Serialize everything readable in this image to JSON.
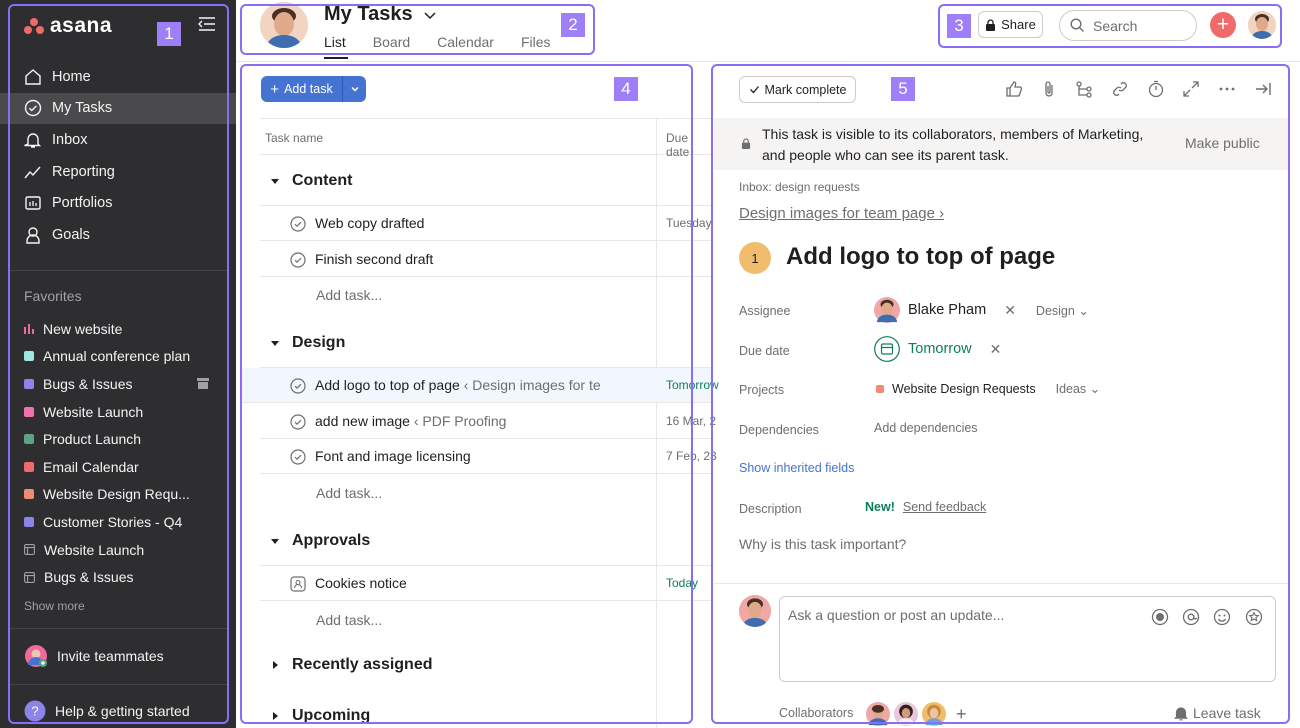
{
  "app": {
    "brand": "asana"
  },
  "sidebar": {
    "nav": [
      {
        "label": "Home",
        "icon": "home-icon"
      },
      {
        "label": "My Tasks",
        "icon": "check-circle-icon",
        "active": true
      },
      {
        "label": "Inbox",
        "icon": "bell-icon"
      },
      {
        "label": "Reporting",
        "icon": "trend-icon"
      },
      {
        "label": "Portfolios",
        "icon": "folder-icon"
      },
      {
        "label": "Goals",
        "icon": "person-icon"
      }
    ],
    "favorites_title": "Favorites",
    "favorites": [
      {
        "label": "New website",
        "color": "#f06a99",
        "kind": "bars"
      },
      {
        "label": "Annual conference plan",
        "color": "#9ee7e3",
        "kind": "square"
      },
      {
        "label": "Bugs & Issues",
        "color": "#8d84e8",
        "kind": "square",
        "archived": true
      },
      {
        "label": "Website Launch",
        "color": "#f26fb2",
        "kind": "square"
      },
      {
        "label": "Product Launch",
        "color": "#5da283",
        "kind": "square"
      },
      {
        "label": "Email Calendar",
        "color": "#f06a6a",
        "kind": "square"
      },
      {
        "label": "Website Design Requ...",
        "color": "#ec8d71",
        "kind": "square"
      },
      {
        "label": "Customer Stories - Q4",
        "color": "#8d84e8",
        "kind": "square"
      },
      {
        "label": "Website Launch",
        "color": "#a2a0a2",
        "kind": "table"
      },
      {
        "label": "Bugs & Issues",
        "color": "#a2a0a2",
        "kind": "table"
      }
    ],
    "show_more": "Show more",
    "invite": "Invite teammates",
    "help": "Help & getting started"
  },
  "header": {
    "title": "My Tasks",
    "tabs": [
      "List",
      "Board",
      "Calendar",
      "Files"
    ],
    "share": "Share",
    "search_placeholder": "Search"
  },
  "annotations": [
    "1",
    "2",
    "3",
    "4",
    "5"
  ],
  "list": {
    "add_task": "Add task",
    "columns": [
      "Task name",
      "Due date"
    ],
    "add_row": "Add task...",
    "sections": [
      {
        "name": "Content",
        "tasks": [
          {
            "name": "Web copy drafted",
            "crumb": "",
            "due": "Tuesday",
            "due_color": "#6d6e6f"
          },
          {
            "name": "Finish second draft",
            "crumb": "",
            "due": "",
            "due_color": "#6d6e6f"
          }
        ]
      },
      {
        "name": "Design",
        "tasks": [
          {
            "name": "Add logo to top of page",
            "crumb": "‹ Design images for te",
            "due": "Tomorrow",
            "due_color": "#0d7f56",
            "highlight": true
          },
          {
            "name": "add new image",
            "crumb": "‹ PDF Proofing",
            "due": "16 Mar, 2",
            "due_color": "#6d6e6f"
          },
          {
            "name": "Font and image licensing",
            "crumb": "",
            "due": "7 Feb, 23",
            "due_color": "#6d6e6f"
          }
        ]
      },
      {
        "name": "Approvals",
        "tasks": [
          {
            "name": "Cookies notice",
            "crumb": "",
            "due": "Today",
            "due_color": "#0d7f56",
            "approval": true
          }
        ]
      }
    ],
    "collapsed_sections": [
      "Recently assigned",
      "Upcoming"
    ]
  },
  "detail": {
    "mark_complete": "Mark complete",
    "banner_line1": "This task is visible to its collaborators, members of Marketing,",
    "banner_line2": "and people who can see its parent task.",
    "make_public": "Make public",
    "inbox_label": "Inbox: design requests",
    "parent_task": "Design images for team page",
    "number": "1",
    "title": "Add logo to top of page",
    "fields": {
      "assignee_label": "Assignee",
      "assignee": "Blake Pham",
      "assignee_section": "Design",
      "due_label": "Due date",
      "due": "Tomorrow",
      "projects_label": "Projects",
      "project": "Website Design Requests",
      "project_section": "Ideas",
      "dependencies_label": "Dependencies",
      "dependencies_action": "Add dependencies",
      "show_inherited": "Show inherited fields",
      "description_label": "Description",
      "new_badge": "New!",
      "send_feedback": "Send feedback",
      "description_placeholder": "Why is this task important?"
    },
    "comment_placeholder": "Ask a question or post an update...",
    "collaborators_label": "Collaborators",
    "leave_task": "Leave task"
  },
  "colors": {
    "sidebar": "#2e2e30",
    "accent": "#4573d2",
    "brand": "#f06a6a",
    "annotation": "#9f7ff7"
  }
}
